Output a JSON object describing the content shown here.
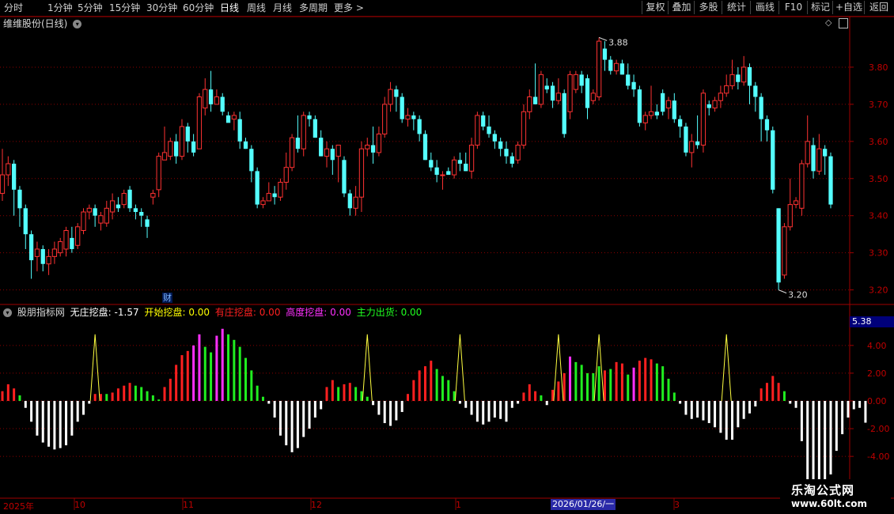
{
  "toolbar": {
    "periods": [
      "分时",
      "1分钟",
      "5分钟",
      "15分钟",
      "30分钟",
      "60分钟",
      "日线",
      "周线",
      "月线",
      "多周期",
      "更多 >"
    ],
    "buttons": [
      "复权",
      "叠加",
      "多股",
      "统计",
      "画线",
      "F10",
      "标记",
      "+自选",
      "返回"
    ]
  },
  "main_panel": {
    "title": "维维股份(日线)",
    "high_label": "3.88",
    "low_label": "3.20",
    "y_ticks": [
      "3.80",
      "3.70",
      "3.60",
      "3.50",
      "3.40",
      "3.30",
      "3.20"
    ],
    "finance_marker": "财"
  },
  "indicator_panel": {
    "name": "股朋指标网",
    "items": [
      {
        "label": "无庄挖盘:",
        "value": "-1.57",
        "color": "#ffffff"
      },
      {
        "label": "开始挖盘:",
        "value": "0.00",
        "color": "#ffff00"
      },
      {
        "label": "有庄挖盘:",
        "value": "0.00",
        "color": "#ff2020"
      },
      {
        "label": "高度挖盘:",
        "value": "0.00",
        "color": "#ff30ff"
      },
      {
        "label": "主力出货:",
        "value": "0.00",
        "color": "#20ff20"
      }
    ],
    "current_value": "5.38",
    "y_ticks": [
      "4.00",
      "2.00",
      "0.00",
      "-2.00",
      "-4.00"
    ]
  },
  "date_axis": {
    "labels": [
      "2025年",
      "10",
      "11",
      "12",
      "1",
      "2026/01/26/一",
      "3"
    ]
  },
  "watermark": {
    "line1": "乐淘公式网",
    "line2": "www.60lt.com"
  },
  "colors": {
    "up": "#ff3232",
    "down": "#54ffff",
    "grid": "#8b0000",
    "border": "#a00000"
  },
  "chart_data": {
    "type": "candlestick",
    "price_range": [
      3.18,
      3.9
    ],
    "candles": [
      [
        3.46,
        3.51,
        3.58,
        3.44
      ],
      [
        3.51,
        3.54,
        3.56,
        3.48
      ],
      [
        3.54,
        3.47,
        3.55,
        3.4
      ],
      [
        3.47,
        3.42,
        3.48,
        3.37
      ],
      [
        3.42,
        3.35,
        3.43,
        3.31
      ],
      [
        3.35,
        3.28,
        3.36,
        3.23
      ],
      [
        3.29,
        3.31,
        3.33,
        3.25
      ],
      [
        3.31,
        3.27,
        3.32,
        3.25
      ],
      [
        3.27,
        3.29,
        3.31,
        3.24
      ],
      [
        3.29,
        3.31,
        3.33,
        3.27
      ],
      [
        3.3,
        3.33,
        3.34,
        3.29
      ],
      [
        3.31,
        3.36,
        3.37,
        3.29
      ],
      [
        3.34,
        3.31,
        3.37,
        3.3
      ],
      [
        3.32,
        3.37,
        3.38,
        3.31
      ],
      [
        3.36,
        3.41,
        3.42,
        3.35
      ],
      [
        3.41,
        3.42,
        3.43,
        3.39
      ],
      [
        3.42,
        3.4,
        3.43,
        3.37
      ],
      [
        3.38,
        3.4,
        3.41,
        3.36
      ],
      [
        3.38,
        3.42,
        3.44,
        3.37
      ],
      [
        3.41,
        3.44,
        3.46,
        3.39
      ],
      [
        3.43,
        3.42,
        3.45,
        3.41
      ],
      [
        3.43,
        3.46,
        3.47,
        3.42
      ],
      [
        3.47,
        3.42,
        3.48,
        3.41
      ],
      [
        3.42,
        3.41,
        3.43,
        3.39
      ],
      [
        3.41,
        3.4,
        3.42,
        3.37
      ],
      [
        3.39,
        3.37,
        3.4,
        3.34
      ],
      [
        3.45,
        3.46,
        3.47,
        3.43
      ],
      [
        3.47,
        3.56,
        3.57,
        3.45
      ],
      [
        3.55,
        3.57,
        3.64,
        3.55
      ],
      [
        3.56,
        3.6,
        3.61,
        3.55
      ],
      [
        3.6,
        3.56,
        3.62,
        3.54
      ],
      [
        3.56,
        3.64,
        3.66,
        3.55
      ],
      [
        3.64,
        3.6,
        3.65,
        3.57
      ],
      [
        3.6,
        3.57,
        3.62,
        3.56
      ],
      [
        3.58,
        3.72,
        3.73,
        3.58
      ],
      [
        3.69,
        3.74,
        3.77,
        3.67
      ],
      [
        3.74,
        3.7,
        3.79,
        3.68
      ],
      [
        3.7,
        3.72,
        3.74,
        3.7
      ],
      [
        3.72,
        3.68,
        3.73,
        3.67
      ],
      [
        3.67,
        3.65,
        3.68,
        3.66
      ],
      [
        3.66,
        3.67,
        3.68,
        3.63
      ],
      [
        3.66,
        3.6,
        3.68,
        3.58
      ],
      [
        3.6,
        3.58,
        3.61,
        3.58
      ],
      [
        3.58,
        3.52,
        3.59,
        3.49
      ],
      [
        3.52,
        3.43,
        3.53,
        3.42
      ],
      [
        3.43,
        3.44,
        3.45,
        3.42
      ],
      [
        3.44,
        3.46,
        3.49,
        3.44
      ],
      [
        3.46,
        3.45,
        3.48,
        3.43
      ],
      [
        3.45,
        3.49,
        3.5,
        3.44
      ],
      [
        3.49,
        3.53,
        3.57,
        3.47
      ],
      [
        3.53,
        3.61,
        3.62,
        3.52
      ],
      [
        3.61,
        3.58,
        3.67,
        3.57
      ],
      [
        3.58,
        3.67,
        3.68,
        3.56
      ],
      [
        3.67,
        3.66,
        3.68,
        3.64
      ],
      [
        3.66,
        3.61,
        3.67,
        3.61
      ],
      [
        3.61,
        3.56,
        3.63,
        3.56
      ],
      [
        3.56,
        3.58,
        3.6,
        3.53
      ],
      [
        3.58,
        3.55,
        3.59,
        3.51
      ],
      [
        3.56,
        3.59,
        3.59,
        3.49
      ],
      [
        3.55,
        3.46,
        3.56,
        3.45
      ],
      [
        3.46,
        3.42,
        3.47,
        3.4
      ],
      [
        3.42,
        3.45,
        3.48,
        3.4
      ],
      [
        3.45,
        3.58,
        3.6,
        3.41
      ],
      [
        3.58,
        3.59,
        3.61,
        3.56
      ],
      [
        3.59,
        3.57,
        3.64,
        3.54
      ],
      [
        3.57,
        3.62,
        3.64,
        3.56
      ],
      [
        3.62,
        3.7,
        3.72,
        3.61
      ],
      [
        3.7,
        3.74,
        3.76,
        3.68
      ],
      [
        3.74,
        3.72,
        3.75,
        3.68
      ],
      [
        3.72,
        3.66,
        3.73,
        3.65
      ],
      [
        3.66,
        3.67,
        3.69,
        3.64
      ],
      [
        3.67,
        3.66,
        3.68,
        3.63
      ],
      [
        3.66,
        3.62,
        3.67,
        3.6
      ],
      [
        3.62,
        3.55,
        3.63,
        3.55
      ],
      [
        3.55,
        3.53,
        3.57,
        3.52
      ],
      [
        3.53,
        3.51,
        3.55,
        3.49
      ],
      [
        3.51,
        3.51,
        3.52,
        3.47
      ],
      [
        3.52,
        3.51,
        3.53,
        3.51
      ],
      [
        3.51,
        3.55,
        3.56,
        3.5
      ],
      [
        3.55,
        3.54,
        3.57,
        3.52
      ],
      [
        3.54,
        3.52,
        3.57,
        3.52
      ],
      [
        3.52,
        3.59,
        3.61,
        3.5
      ],
      [
        3.59,
        3.67,
        3.68,
        3.58
      ],
      [
        3.67,
        3.64,
        3.68,
        3.63
      ],
      [
        3.64,
        3.62,
        3.67,
        3.61
      ],
      [
        3.62,
        3.6,
        3.63,
        3.58
      ],
      [
        3.6,
        3.58,
        3.61,
        3.56
      ],
      [
        3.58,
        3.56,
        3.6,
        3.54
      ],
      [
        3.56,
        3.54,
        3.57,
        3.53
      ],
      [
        3.55,
        3.59,
        3.6,
        3.54
      ],
      [
        3.59,
        3.68,
        3.7,
        3.58
      ],
      [
        3.68,
        3.72,
        3.74,
        3.66
      ],
      [
        3.72,
        3.7,
        3.81,
        3.7
      ],
      [
        3.7,
        3.78,
        3.79,
        3.69
      ],
      [
        3.75,
        3.74,
        3.77,
        3.73
      ],
      [
        3.75,
        3.71,
        3.76,
        3.69
      ],
      [
        3.71,
        3.73,
        3.77,
        3.7
      ],
      [
        3.73,
        3.62,
        3.74,
        3.61
      ],
      [
        3.68,
        3.78,
        3.79,
        3.66
      ],
      [
        3.74,
        3.78,
        3.79,
        3.73
      ],
      [
        3.78,
        3.75,
        3.79,
        3.73
      ],
      [
        3.77,
        3.69,
        3.78,
        3.66
      ],
      [
        3.71,
        3.73,
        3.74,
        3.7
      ],
      [
        3.72,
        3.87,
        3.88,
        3.71
      ],
      [
        3.85,
        3.82,
        3.87,
        3.79
      ],
      [
        3.82,
        3.79,
        3.83,
        3.78
      ],
      [
        3.79,
        3.81,
        3.82,
        3.78
      ],
      [
        3.81,
        3.78,
        3.82,
        3.78
      ],
      [
        3.78,
        3.75,
        3.81,
        3.74
      ],
      [
        3.76,
        3.74,
        3.78,
        3.72
      ],
      [
        3.74,
        3.65,
        3.75,
        3.64
      ],
      [
        3.65,
        3.67,
        3.68,
        3.63
      ],
      [
        3.67,
        3.68,
        3.75,
        3.66
      ],
      [
        3.68,
        3.67,
        3.7,
        3.66
      ],
      [
        3.73,
        3.68,
        3.74,
        3.67
      ],
      [
        3.69,
        3.71,
        3.72,
        3.66
      ],
      [
        3.71,
        3.66,
        3.73,
        3.65
      ],
      [
        3.66,
        3.64,
        3.67,
        3.61
      ],
      [
        3.64,
        3.57,
        3.65,
        3.56
      ],
      [
        3.57,
        3.6,
        3.62,
        3.53
      ],
      [
        3.6,
        3.59,
        3.67,
        3.58
      ],
      [
        3.59,
        3.73,
        3.74,
        3.57
      ],
      [
        3.7,
        3.69,
        3.71,
        3.67
      ],
      [
        3.69,
        3.71,
        3.72,
        3.68
      ],
      [
        3.71,
        3.73,
        3.75,
        3.69
      ],
      [
        3.73,
        3.75,
        3.78,
        3.72
      ],
      [
        3.75,
        3.78,
        3.82,
        3.74
      ],
      [
        3.78,
        3.76,
        3.8,
        3.74
      ],
      [
        3.76,
        3.8,
        3.83,
        3.75
      ],
      [
        3.8,
        3.75,
        3.81,
        3.7
      ],
      [
        3.75,
        3.72,
        3.76,
        3.68
      ],
      [
        3.72,
        3.66,
        3.73,
        3.6
      ],
      [
        3.66,
        3.63,
        3.67,
        3.6
      ],
      [
        3.63,
        3.47,
        3.64,
        3.46
      ],
      [
        3.42,
        3.22,
        3.42,
        3.2
      ],
      [
        3.24,
        3.37,
        3.38,
        3.23
      ],
      [
        3.37,
        3.43,
        3.5,
        3.36
      ],
      [
        3.43,
        3.44,
        3.45,
        3.42
      ],
      [
        3.42,
        3.54,
        3.55,
        3.4
      ],
      [
        3.54,
        3.6,
        3.67,
        3.53
      ],
      [
        3.59,
        3.52,
        3.61,
        3.5
      ],
      [
        3.52,
        3.58,
        3.62,
        3.51
      ],
      [
        3.58,
        3.56,
        3.59,
        3.51
      ],
      [
        3.56,
        3.43,
        3.57,
        3.42
      ]
    ],
    "indicator": {
      "y_range": [
        -6.9,
        6.1
      ],
      "bars": [
        [
          0.7,
          "r"
        ],
        [
          1.2,
          "r"
        ],
        [
          0.9,
          "r"
        ],
        [
          0.4,
          "g"
        ],
        [
          -0.5,
          "w"
        ],
        [
          -1.5,
          "w"
        ],
        [
          -2.5,
          "w"
        ],
        [
          -3.0,
          "w"
        ],
        [
          -3.3,
          "w"
        ],
        [
          -3.5,
          "w"
        ],
        [
          -3.4,
          "w"
        ],
        [
          -3.2,
          "w"
        ],
        [
          -2.5,
          "w"
        ],
        [
          -1.5,
          "w"
        ],
        [
          -1.0,
          "w"
        ],
        [
          -0.2,
          "w"
        ],
        [
          0.5,
          "r"
        ],
        [
          0.5,
          "r"
        ],
        [
          0.5,
          "g"
        ],
        [
          0.6,
          "r"
        ],
        [
          0.9,
          "r"
        ],
        [
          1.1,
          "r"
        ],
        [
          1.3,
          "r"
        ],
        [
          1.1,
          "g"
        ],
        [
          1.0,
          "g"
        ],
        [
          0.7,
          "g"
        ],
        [
          0.4,
          "g"
        ],
        [
          0.1,
          "g"
        ],
        [
          1.0,
          "r"
        ],
        [
          1.6,
          "r"
        ],
        [
          2.6,
          "r"
        ],
        [
          3.3,
          "r"
        ],
        [
          3.6,
          "r"
        ],
        [
          4.0,
          "m"
        ],
        [
          4.8,
          "m"
        ],
        [
          3.9,
          "g"
        ],
        [
          3.5,
          "g"
        ],
        [
          4.7,
          "m"
        ],
        [
          5.2,
          "m"
        ],
        [
          4.8,
          "g"
        ],
        [
          4.4,
          "g"
        ],
        [
          3.9,
          "g"
        ],
        [
          3.1,
          "g"
        ],
        [
          2.2,
          "g"
        ],
        [
          1.1,
          "g"
        ],
        [
          0.3,
          "g"
        ],
        [
          -0.2,
          "w"
        ],
        [
          -1.2,
          "w"
        ],
        [
          -2.5,
          "w"
        ],
        [
          -3.2,
          "w"
        ],
        [
          -3.7,
          "w"
        ],
        [
          -3.4,
          "w"
        ],
        [
          -2.6,
          "w"
        ],
        [
          -2.0,
          "w"
        ],
        [
          -1.2,
          "w"
        ],
        [
          -0.6,
          "w"
        ],
        [
          1.0,
          "r"
        ],
        [
          1.5,
          "r"
        ],
        [
          1.0,
          "g"
        ],
        [
          1.2,
          "r"
        ],
        [
          1.3,
          "r"
        ],
        [
          1.0,
          "g"
        ],
        [
          0.7,
          "g"
        ],
        [
          0.3,
          "g"
        ],
        [
          -0.3,
          "w"
        ],
        [
          -1.0,
          "w"
        ],
        [
          -1.6,
          "w"
        ],
        [
          -1.8,
          "w"
        ],
        [
          -1.4,
          "w"
        ],
        [
          -0.8,
          "w"
        ],
        [
          0.5,
          "r"
        ],
        [
          1.5,
          "r"
        ],
        [
          2.2,
          "r"
        ],
        [
          2.5,
          "r"
        ],
        [
          2.9,
          "r"
        ],
        [
          2.3,
          "g"
        ],
        [
          1.8,
          "g"
        ],
        [
          1.5,
          "g"
        ],
        [
          0.7,
          "g"
        ],
        [
          -0.2,
          "w"
        ],
        [
          -0.5,
          "w"
        ],
        [
          -1.0,
          "w"
        ],
        [
          -1.5,
          "w"
        ],
        [
          -1.7,
          "w"
        ],
        [
          -1.5,
          "w"
        ],
        [
          -1.2,
          "w"
        ],
        [
          -1.3,
          "w"
        ],
        [
          -1.5,
          "w"
        ],
        [
          -0.5,
          "w"
        ],
        [
          -0.2,
          "w"
        ],
        [
          0.6,
          "r"
        ],
        [
          1.2,
          "r"
        ],
        [
          0.7,
          "r"
        ],
        [
          0.4,
          "g"
        ],
        [
          -0.3,
          "w"
        ],
        [
          0.8,
          "r"
        ],
        [
          1.4,
          "r"
        ],
        [
          2.0,
          "r"
        ],
        [
          3.2,
          "m"
        ],
        [
          2.8,
          "g"
        ],
        [
          2.6,
          "g"
        ],
        [
          2.0,
          "g"
        ],
        [
          2.0,
          "g"
        ],
        [
          2.5,
          "g"
        ],
        [
          2.2,
          "r"
        ],
        [
          2.3,
          "g"
        ],
        [
          2.8,
          "r"
        ],
        [
          2.7,
          "r"
        ],
        [
          1.9,
          "g"
        ],
        [
          2.4,
          "m"
        ],
        [
          2.9,
          "r"
        ],
        [
          3.1,
          "r"
        ],
        [
          3.0,
          "r"
        ],
        [
          2.7,
          "g"
        ],
        [
          2.5,
          "g"
        ],
        [
          1.6,
          "g"
        ],
        [
          0.6,
          "g"
        ],
        [
          -0.2,
          "w"
        ],
        [
          -1.0,
          "w"
        ],
        [
          -1.3,
          "w"
        ],
        [
          -1.2,
          "w"
        ],
        [
          -1.4,
          "w"
        ],
        [
          -1.6,
          "w"
        ],
        [
          -1.9,
          "w"
        ],
        [
          -2.3,
          "w"
        ],
        [
          -2.8,
          "w"
        ],
        [
          -2.8,
          "w"
        ],
        [
          -1.9,
          "w"
        ],
        [
          -1.3,
          "w"
        ],
        [
          -0.9,
          "w"
        ],
        [
          -0.4,
          "w"
        ],
        [
          0.9,
          "r"
        ],
        [
          1.3,
          "r"
        ],
        [
          1.8,
          "r"
        ],
        [
          1.3,
          "r"
        ],
        [
          0.7,
          "g"
        ],
        [
          -0.2,
          "w"
        ],
        [
          -0.5,
          "w"
        ],
        [
          -2.9,
          "w"
        ],
        [
          -6.9,
          "w"
        ],
        [
          -6.0,
          "w"
        ],
        [
          -6.0,
          "w"
        ],
        [
          -5.8,
          "w"
        ],
        [
          -5.3,
          "w"
        ],
        [
          -3.6,
          "w"
        ],
        [
          -2.4,
          "w"
        ],
        [
          -1.2,
          "w"
        ],
        [
          -0.6,
          "w"
        ],
        [
          -0.5,
          "w"
        ],
        [
          -1.57,
          "w"
        ]
      ],
      "peak_value": 4.8,
      "peak_positions": [
        16,
        63,
        79,
        96,
        103,
        125
      ]
    }
  }
}
